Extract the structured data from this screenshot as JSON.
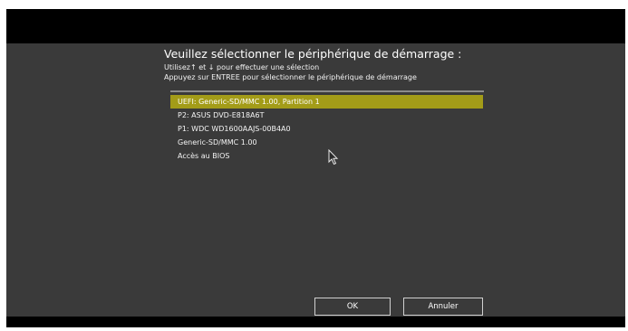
{
  "dialog": {
    "title": "Veuillez sélectionner le périphérique de démarrage :",
    "instruction_line1": "Utilisez↑ et ↓ pour effectuer une sélection",
    "instruction_line2": "Appuyez sur ENTREE pour sélectionner le périphérique de démarrage"
  },
  "devices": [
    "UEFI: Generic-SD/MMC 1.00, Partition 1",
    "P2: ASUS    DVD-E818A6T",
    "P1: WDC WD1600AAJS-00B4A0",
    "Generic-SD/MMC 1.00",
    "Accès au BIOS"
  ],
  "selected_index": 0,
  "buttons": {
    "ok_label": "OK",
    "cancel_label": "Annuler"
  },
  "colors": {
    "screen_bg": "#3a3a3a",
    "bars": "#000000",
    "selection": "#a39c18",
    "text": "#ffffff"
  },
  "icons": {
    "cursor": "mouse-pointer-icon"
  }
}
